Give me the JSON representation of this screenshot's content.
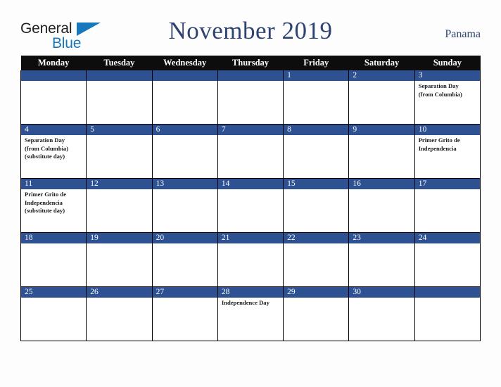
{
  "brand": {
    "word_one": "General",
    "word_two": "Blue",
    "accent_color": "#1878be",
    "text_color": "#231f20"
  },
  "header": {
    "title": "November 2019",
    "country": "Panama",
    "title_color": "#2e4372"
  },
  "colors": {
    "weekday_header_bg": "#0d0d0d",
    "weekday_header_text": "#ffffff",
    "day_number_bg": "#2e5192",
    "day_number_text": "#ffffff",
    "cell_bg": "#ffffff",
    "grid_line": "#000000",
    "page_bg": "#fdfdfd",
    "event_text": "#1a1a1a"
  },
  "weekdays": [
    "Monday",
    "Tuesday",
    "Wednesday",
    "Thursday",
    "Friday",
    "Saturday",
    "Sunday"
  ],
  "weeks": [
    [
      {
        "day": "",
        "events": []
      },
      {
        "day": "",
        "events": []
      },
      {
        "day": "",
        "events": []
      },
      {
        "day": "",
        "events": []
      },
      {
        "day": "1",
        "events": []
      },
      {
        "day": "2",
        "events": []
      },
      {
        "day": "3",
        "events": [
          "Separation Day",
          "(from Columbia)"
        ]
      }
    ],
    [
      {
        "day": "4",
        "events": [
          "Separation Day",
          "(from Columbia)",
          "(substitute day)"
        ]
      },
      {
        "day": "5",
        "events": []
      },
      {
        "day": "6",
        "events": []
      },
      {
        "day": "7",
        "events": []
      },
      {
        "day": "8",
        "events": []
      },
      {
        "day": "9",
        "events": []
      },
      {
        "day": "10",
        "events": [
          "Primer Grito de",
          "Independencia"
        ]
      }
    ],
    [
      {
        "day": "11",
        "events": [
          "Primer Grito de",
          "Independencia",
          "(substitute day)"
        ]
      },
      {
        "day": "12",
        "events": []
      },
      {
        "day": "13",
        "events": []
      },
      {
        "day": "14",
        "events": []
      },
      {
        "day": "15",
        "events": []
      },
      {
        "day": "16",
        "events": []
      },
      {
        "day": "17",
        "events": []
      }
    ],
    [
      {
        "day": "18",
        "events": []
      },
      {
        "day": "19",
        "events": []
      },
      {
        "day": "20",
        "events": []
      },
      {
        "day": "21",
        "events": []
      },
      {
        "day": "22",
        "events": []
      },
      {
        "day": "23",
        "events": []
      },
      {
        "day": "24",
        "events": []
      }
    ],
    [
      {
        "day": "25",
        "events": []
      },
      {
        "day": "26",
        "events": []
      },
      {
        "day": "27",
        "events": []
      },
      {
        "day": "28",
        "events": [
          "Independence Day"
        ]
      },
      {
        "day": "29",
        "events": []
      },
      {
        "day": "30",
        "events": []
      },
      {
        "day": "",
        "events": []
      }
    ]
  ]
}
